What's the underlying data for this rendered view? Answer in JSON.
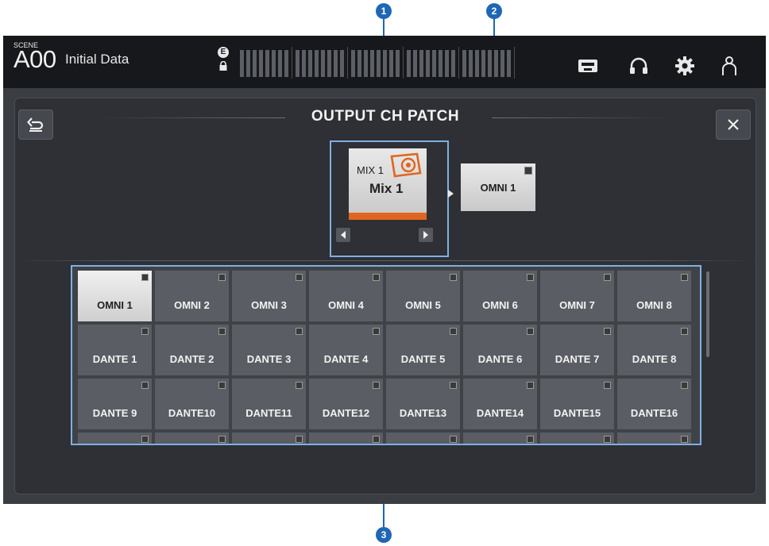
{
  "callouts": [
    "1",
    "2",
    "3"
  ],
  "topbar": {
    "scene_label": "SCENE",
    "scene_number": "A00",
    "scene_name": "Initial Data",
    "e_badge": "E",
    "icons": [
      "recorder-icon",
      "headphones-icon",
      "gear-icon",
      "user-icon"
    ]
  },
  "panel": {
    "title": "OUTPUT CH PATCH",
    "back_icon": "back-arrow-icon",
    "close_icon": "close-icon",
    "source": {
      "line1": "MIX 1",
      "line2": "Mix 1",
      "accent_color": "#e0651f"
    },
    "destination": "OMNI 1"
  },
  "ports": [
    "OMNI 1",
    "OMNI 2",
    "OMNI 3",
    "OMNI 4",
    "OMNI 5",
    "OMNI 6",
    "OMNI 7",
    "OMNI 8",
    "DANTE 1",
    "DANTE 2",
    "DANTE 3",
    "DANTE 4",
    "DANTE 5",
    "DANTE 6",
    "DANTE 7",
    "DANTE 8",
    "DANTE 9",
    "DANTE10",
    "DANTE11",
    "DANTE12",
    "DANTE13",
    "DANTE14",
    "DANTE15",
    "DANTE16"
  ],
  "selected_port": "OMNI 1",
  "colors": {
    "accent": "#e0651f",
    "callout": "#1f67b4",
    "highlight_frame": "#7fb0e3"
  }
}
